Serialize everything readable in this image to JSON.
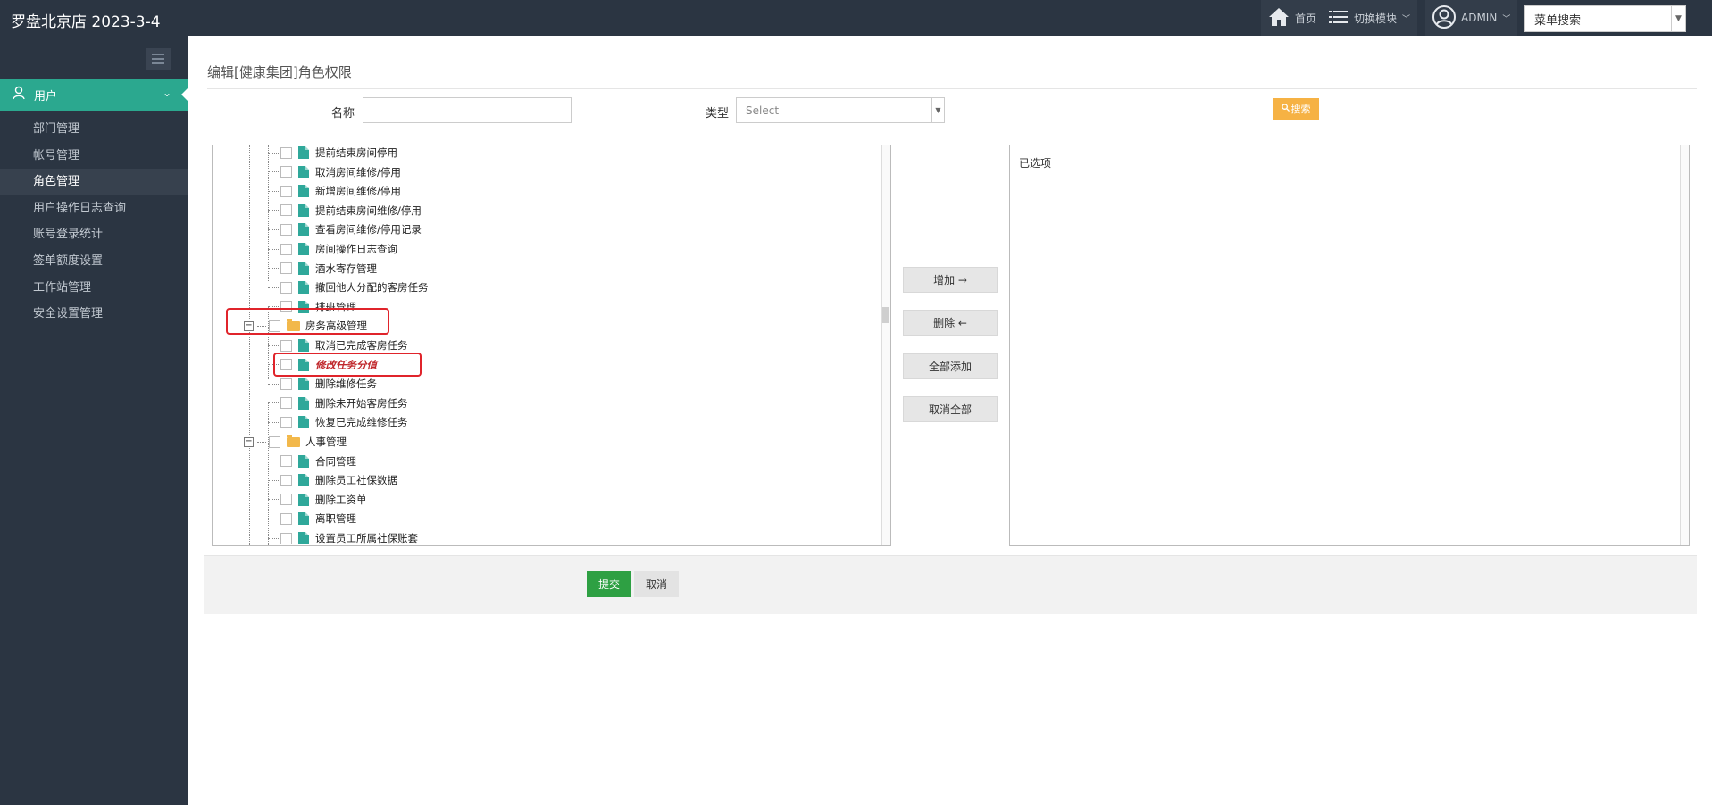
{
  "header": {
    "brand": "罗盘北京店 2023-3-4",
    "home_label": "首页",
    "module_label": "切换模块",
    "admin_label": "ADMIN",
    "menu_search_placeholder": "菜单搜索"
  },
  "sidebar": {
    "section_label": "用户",
    "items": [
      {
        "label": "部门管理"
      },
      {
        "label": "帐号管理"
      },
      {
        "label": "角色管理",
        "active": true
      },
      {
        "label": "用户操作日志查询"
      },
      {
        "label": "账号登录统计"
      },
      {
        "label": "签单额度设置"
      },
      {
        "label": "工作站管理"
      },
      {
        "label": "安全设置管理"
      }
    ]
  },
  "main": {
    "title": "编辑[健康集团]角色权限",
    "name_label": "名称",
    "name_value": "",
    "type_label": "类型",
    "type_placeholder": "Select",
    "search_label": "搜索"
  },
  "tree": {
    "group1_items": [
      "提前结束房间停用",
      "取消房间维修/停用",
      "新增房间维修/停用",
      "提前结束房间维修/停用",
      "查看房间维修/停用记录",
      "房间操作日志查询",
      "酒水寄存管理",
      "撤回他人分配的客房任务",
      "排班管理"
    ],
    "folder2": "房务高级管理",
    "group2_items": [
      "取消已完成客房任务",
      "修改任务分值",
      "删除维修任务",
      "删除未开始客房任务",
      "恢复已完成维修任务"
    ],
    "folder3": "人事管理",
    "group3_items": [
      "合同管理",
      "删除员工社保数据",
      "删除工资单",
      "离职管理",
      "设置员工所属社保账套"
    ]
  },
  "actions": {
    "add": "增加 →",
    "remove": "删除 ←",
    "add_all": "全部添加",
    "cancel_all": "取消全部"
  },
  "selected": {
    "title": "已选项"
  },
  "footer": {
    "submit": "提交",
    "cancel": "取消"
  },
  "colors": {
    "sidebar_bg": "#2b3542",
    "accent": "#2ba88f",
    "submit": "#2ea043",
    "search": "#f6b244",
    "highlight": "#e0242b"
  }
}
